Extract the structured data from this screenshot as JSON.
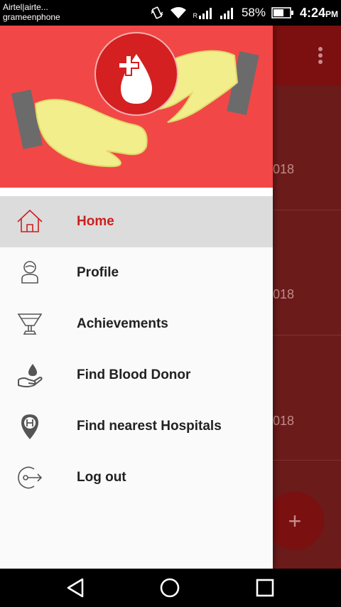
{
  "status_bar": {
    "carrier_line1": "Airtel|airte...",
    "carrier_line2": "grameenphone",
    "sim_label": "R",
    "battery_percent": "58%",
    "time": "4:24",
    "time_suffix": "PM",
    "icons": [
      "vibrate-icon",
      "wifi-icon",
      "signal-icon",
      "signal-icon",
      "battery-icon"
    ]
  },
  "background_app": {
    "card_years": [
      "018",
      "018",
      "018"
    ],
    "fab_label": "+"
  },
  "drawer": {
    "header_colors": {
      "background": "#f24747",
      "hands": "#f2ee8c",
      "logo": "#d42020"
    },
    "items": [
      {
        "label": "Home",
        "icon": "home-icon",
        "active": true
      },
      {
        "label": "Profile",
        "icon": "profile-icon",
        "active": false
      },
      {
        "label": "Achievements",
        "icon": "trophy-icon",
        "active": false
      },
      {
        "label": "Find Blood Donor",
        "icon": "blood-donor-icon",
        "active": false
      },
      {
        "label": "Find nearest Hospitals",
        "icon": "hospital-pin-icon",
        "active": false
      },
      {
        "label": "Log out",
        "icon": "logout-icon",
        "active": false
      }
    ],
    "accent_color": "#cc1f1f"
  },
  "nav_bar": {
    "buttons": [
      "back-icon",
      "home-circle-icon",
      "recents-icon"
    ]
  }
}
